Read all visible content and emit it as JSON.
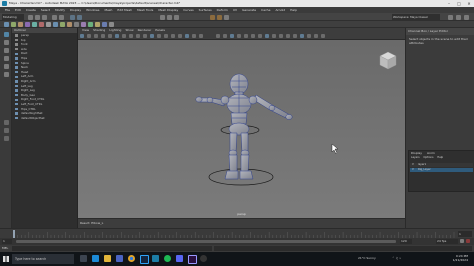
{
  "window": {
    "title": "Maya - Character.mb* - Autodesk MAYA 2023 — C:\\Users\\Documents\\maya\\projects\\default\\scenes\\Character.mb*",
    "minimize": "–",
    "maximize": "□",
    "close": "✕"
  },
  "menus": [
    "File",
    "Edit",
    "Create",
    "Select",
    "Modify",
    "Display",
    "Windows",
    "Mesh",
    "Edit Mesh",
    "Mesh Tools",
    "Mesh Display",
    "Curves",
    "Surfaces",
    "Deform",
    "UV",
    "Generate",
    "Cache",
    "Arnold",
    "Help"
  ],
  "status": {
    "mode": "Modeling",
    "workspace": "Workspace: Maya Classic"
  },
  "outliner": {
    "header": "Outliner",
    "items": [
      "persp",
      "top",
      "front",
      "side",
      "Root",
      "Hips",
      "Spine",
      "Neck",
      "Head",
      "Left_Arm",
      "Right_Arm",
      "Left_Leg",
      "Right_Leg",
      "Body_Geo",
      "Right_Foot_CTRL",
      "Left_Foot_CTRL",
      "Hips_CTRL",
      "defaultLightSet",
      "defaultObjectSet"
    ]
  },
  "viewport": {
    "menus": [
      "View",
      "Shading",
      "Lighting",
      "Show",
      "Renderer",
      "Panels"
    ],
    "camera_label": "persp",
    "footer": "Result: Elbow_L"
  },
  "attribute_editor": {
    "tab": "Channel Box / Layer Editor",
    "message": "Select objects in the scene to edit their attributes",
    "layer_menus": [
      "Display",
      "Anim"
    ],
    "layer_opts": [
      "Layers",
      "Options",
      "Help"
    ],
    "layers": [
      {
        "name": "layer1",
        "vis": "V",
        "selected": false
      },
      {
        "name": "Rig_Layer",
        "vis": "V",
        "selected": true
      }
    ]
  },
  "timeline": {
    "start": "1",
    "end": "120",
    "current": "1",
    "fps": "24 fps"
  },
  "command": {
    "label": "MEL"
  },
  "taskbar": {
    "search_placeholder": "Type here to search",
    "weather": "21°C Sunny",
    "time": "9:24 PM",
    "date": "1/21/2024"
  },
  "colors": {
    "viewport_bg": "#6f6f6f",
    "accent": "#5285a6",
    "selected_blue": "#2f5b7c"
  }
}
